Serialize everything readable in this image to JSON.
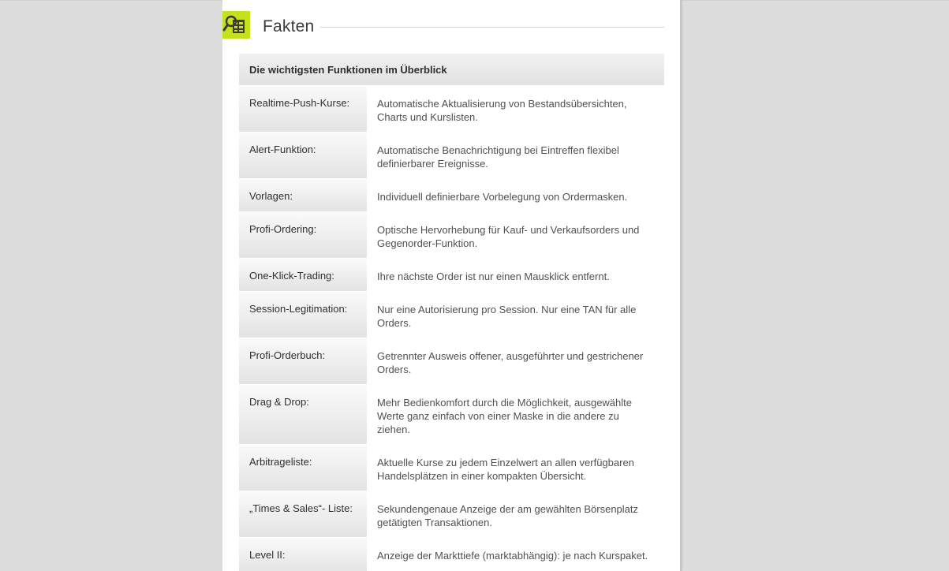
{
  "section": {
    "title": "Fakten",
    "icon": "document-search-icon",
    "icon_color": "#c5e01c"
  },
  "table": {
    "header": "Die wichtigsten Funktionen im Überblick",
    "rows": [
      {
        "label": "Realtime-Push-Kurse:",
        "description": "Automatische Aktualisierung von Bestandsübersichten, Charts und Kurslisten."
      },
      {
        "label": "Alert-Funktion:",
        "description": "Automatische Benachrichtigung bei Eintreffen flexibel definierbarer Ereignisse."
      },
      {
        "label": "Vorlagen:",
        "description": "Individuell definierbare Vorbelegung von Ordermasken."
      },
      {
        "label": "Profi-Ordering:",
        "description": "Optische Hervorhebung für Kauf- und Verkaufsorders und Gegenorder-Funktion."
      },
      {
        "label": "One-Klick-Trading:",
        "description": "Ihre nächste Order ist nur einen Mausklick entfernt."
      },
      {
        "label": "Session-Legitimation:",
        "description": "Nur eine Autorisierung pro Session. Nur eine TAN für alle Orders."
      },
      {
        "label": "Profi-Orderbuch:",
        "description": "Getrennter Ausweis offener, ausgeführter und gestrichener Orders."
      },
      {
        "label": "Drag & Drop:",
        "description": "Mehr Bedienkomfort durch die Möglichkeit, ausgewählte Werte ganz einfach von einer Maske in die andere zu ziehen."
      },
      {
        "label": "Arbitrageliste:",
        "description": "Aktuelle Kurse zu jedem Einzelwert an allen verfügbaren Handelsplätzen in einer kompakten Übersicht."
      },
      {
        "label": "„Times & Sales“- Liste:",
        "description": "Sekundengenaue Anzeige der am gewählten Börsenplatz getätigten Transaktionen."
      },
      {
        "label": "Level II:",
        "description": "Anzeige der Markttiefe (marktabhängig): je nach Kurspaket."
      }
    ]
  }
}
